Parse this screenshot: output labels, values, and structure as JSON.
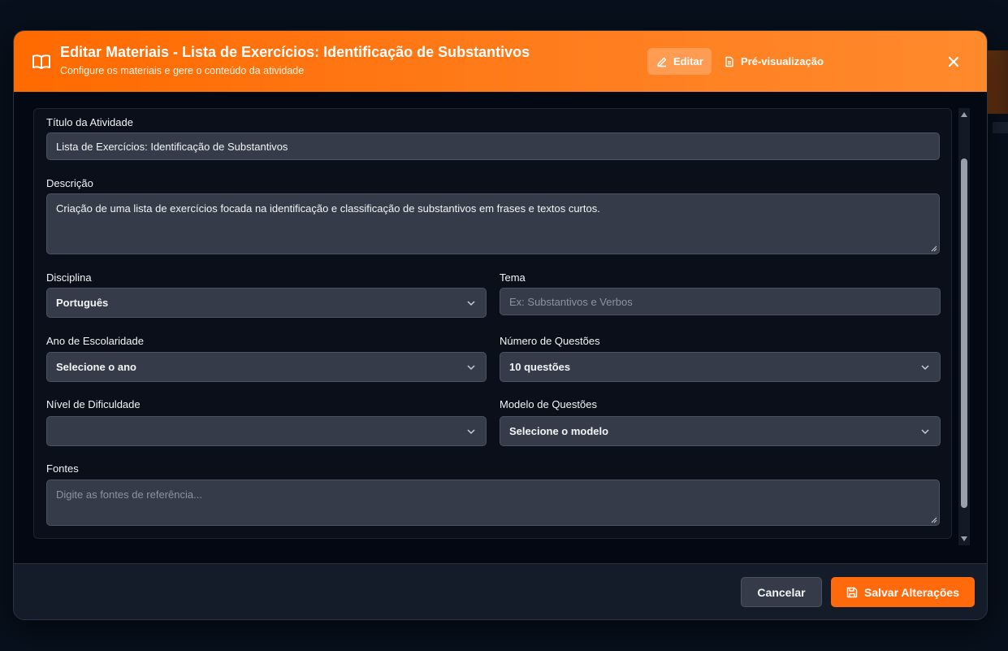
{
  "header": {
    "title": "Editar Materiais - Lista de Exercícios: Identificação de Substantivos",
    "subtitle": "Configure os materiais e gere o conteúdo da atividade",
    "tabs": [
      {
        "label": "Editar",
        "icon": "pencil-icon",
        "active": true
      },
      {
        "label": "Pré-visualização",
        "icon": "document-icon",
        "active": false
      }
    ],
    "accent_color": "#ff6a00"
  },
  "form": {
    "title_field": {
      "label": "Título da Atividade",
      "value": "Lista de Exercícios: Identificação de Substantivos"
    },
    "description_field": {
      "label": "Descrição",
      "value": "Criação de uma lista de exercícios focada na identificação e classificação de substantivos em frases e textos curtos."
    },
    "discipline_field": {
      "label": "Disciplina",
      "value": "Português"
    },
    "theme_field": {
      "label": "Tema",
      "placeholder": "Ex: Substantivos e Verbos"
    },
    "grade_field": {
      "label": "Ano de Escolaridade",
      "value": "Selecione o ano"
    },
    "questions_count_field": {
      "label": "Número de Questões",
      "value": "10 questões"
    },
    "difficulty_field": {
      "label": "Nível de Dificuldade",
      "value": ""
    },
    "question_model_field": {
      "label": "Modelo de Questões",
      "value": "Selecione o modelo"
    },
    "sources_field": {
      "label": "Fontes",
      "placeholder": "Digite as fontes de referência..."
    }
  },
  "footer": {
    "cancel_label": "Cancelar",
    "save_label": "Salvar Alterações",
    "save_color": "#ff6a0d"
  }
}
